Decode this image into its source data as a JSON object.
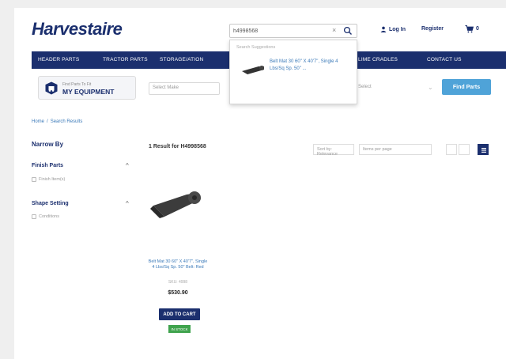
{
  "header": {
    "logo": "Harvestaire",
    "search": {
      "value": "h4998568",
      "clear": "×"
    },
    "login_label": "Log In",
    "register_label": "Register",
    "cart_count": "0"
  },
  "nav": {
    "items": [
      "HEADER PARTS",
      "TRACTOR PARTS",
      "STORAGE/ATION",
      "LIME CRADLES",
      "CONTACT US"
    ]
  },
  "equipment": {
    "small_label": "Find Parts To Fit",
    "big_label": "MY EQUIPMENT",
    "select_placeholder": "Select Make",
    "select_right": "Select",
    "find_parts": "Find Parts"
  },
  "dropdown": {
    "header": "Search Suggestions",
    "suggestion": "Belt Mat 30 60\" X 40'7\", Single 4 Lbs/Sq Sp. 50\" ..."
  },
  "breadcrumb": [
    "Home",
    "Search Results"
  ],
  "sidebar": {
    "title": "Narrow By",
    "facets": [
      {
        "label": "Finish Parts",
        "option": "Finish Item(s)"
      },
      {
        "label": "Shape Setting",
        "option": "Conditions"
      }
    ]
  },
  "results": {
    "summary": "1 Result for H4998568",
    "sort": "Sort by: Relevance",
    "per_page": "Items per page"
  },
  "product": {
    "title": "Belt Mat 30 60\" X 40'7\", Single 4 Lbs/Sq Sp. 50\" Belt: Red",
    "sku": "SKU: 4998",
    "price": "$530.90",
    "add_to_cart": "ADD TO CART",
    "stock": "IN STOCK"
  },
  "colors": {
    "brand": "#1b2f6e",
    "accent": "#4fa3d8",
    "stock": "#3fa34d"
  }
}
